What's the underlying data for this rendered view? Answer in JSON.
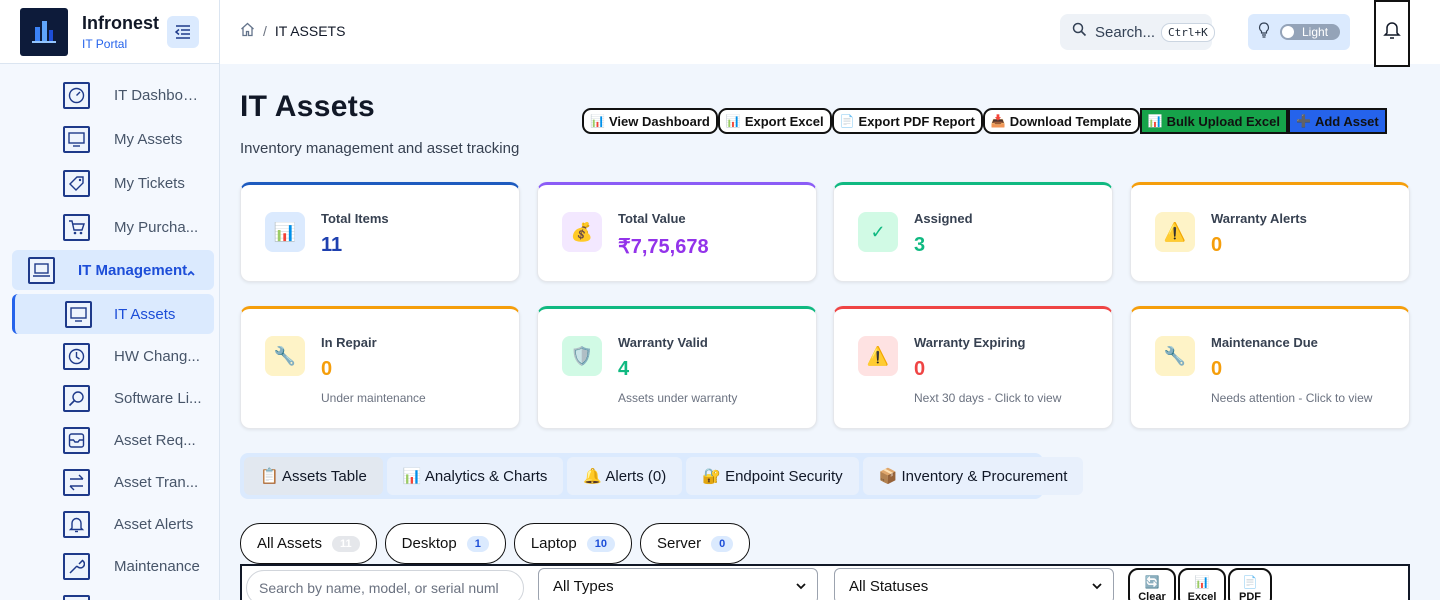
{
  "brand": {
    "name": "Infronest",
    "subtitle": "IT Portal"
  },
  "sidebar": {
    "items": [
      {
        "label": "IT Dashboard",
        "icon": "speedometer-icon"
      },
      {
        "label": "My Assets",
        "icon": "monitor-icon"
      },
      {
        "label": "My Tickets",
        "icon": "ticket-icon"
      },
      {
        "label": "My Purcha...",
        "icon": "cart-icon"
      }
    ],
    "group": {
      "label": "IT Management",
      "icon": "laptop-icon"
    },
    "active": {
      "label": "IT Assets",
      "icon": "monitor-icon"
    },
    "sub_items": [
      {
        "label": "HW Chang...",
        "icon": "clock-icon"
      },
      {
        "label": "Software Li...",
        "icon": "search-icon"
      },
      {
        "label": "Asset Req...",
        "icon": "inbox-icon"
      },
      {
        "label": "Asset Tran...",
        "icon": "transfer-icon"
      },
      {
        "label": "Asset Alerts",
        "icon": "bell-icon"
      },
      {
        "label": "Maintenance",
        "icon": "wrench-icon"
      }
    ]
  },
  "topbar": {
    "breadcrumb": {
      "current": "IT ASSETS",
      "separator": "/"
    },
    "search": {
      "label": "Search...",
      "shortcut": "Ctrl+K"
    },
    "theme": {
      "label": "Light"
    }
  },
  "header": {
    "title": "IT Assets",
    "subtitle": "Inventory management and asset tracking",
    "actions": [
      {
        "label": "View Dashboard",
        "icon": "📊"
      },
      {
        "label": "Export Excel",
        "icon": "📊"
      },
      {
        "label": "Export PDF Report",
        "icon": "📄"
      },
      {
        "label": "Download Template",
        "icon": "📥"
      },
      {
        "label": "Bulk Upload Excel",
        "icon": "📊"
      },
      {
        "label": "Add Asset",
        "icon": "➕"
      }
    ]
  },
  "stats": [
    {
      "label": "Total Items",
      "value": "11",
      "note": "",
      "icon": "📊",
      "color": "#1e40af",
      "accent": "#1e5bbf",
      "icon_bg": "#dbeafe"
    },
    {
      "label": "Total Value",
      "value": "₹7,75,678",
      "note": "",
      "icon": "💰",
      "color": "#9333ea",
      "accent": "#8b5cf6",
      "icon_bg": "#f3e8ff"
    },
    {
      "label": "Assigned",
      "value": "3",
      "note": "",
      "icon": "✓",
      "color": "#10b981",
      "accent": "#10b981",
      "icon_bg": "#d1fae5"
    },
    {
      "label": "Warranty Alerts",
      "value": "0",
      "note": "",
      "icon": "⚠️",
      "color": "#f59e0b",
      "accent": "#f59e0b",
      "icon_bg": "#fef3c7"
    },
    {
      "label": "In Repair",
      "value": "0",
      "note": "Under maintenance",
      "icon": "🔧",
      "color": "#f59e0b",
      "accent": "#f59e0b",
      "icon_bg": "#fef3c7"
    },
    {
      "label": "Warranty Valid",
      "value": "4",
      "note": "Assets under warranty",
      "icon": "🛡️",
      "color": "#10b981",
      "accent": "#10b981",
      "icon_bg": "#d1fae5"
    },
    {
      "label": "Warranty Expiring",
      "value": "0",
      "note": "Next 30 days - Click to view",
      "icon": "⚠️",
      "color": "#ef4444",
      "accent": "#ef4444",
      "icon_bg": "#fee2e2"
    },
    {
      "label": "Maintenance Due",
      "value": "0",
      "note": "Needs attention - Click to view",
      "icon": "🔧",
      "color": "#f59e0b",
      "accent": "#f59e0b",
      "icon_bg": "#fef3c7"
    }
  ],
  "tabs": [
    {
      "label": "📋 Assets Table"
    },
    {
      "label": "📊 Analytics & Charts"
    },
    {
      "label": "🔔 Alerts (0)"
    },
    {
      "label": "🔐 Endpoint Security"
    },
    {
      "label": "📦 Inventory & Procurement"
    }
  ],
  "type_filters": [
    {
      "label": "All Assets",
      "count": "11"
    },
    {
      "label": "Desktop",
      "count": "1"
    },
    {
      "label": "Laptop",
      "count": "10"
    },
    {
      "label": "Server",
      "count": "0"
    }
  ],
  "filters": {
    "search_placeholder": "Search by name, model, or serial numl",
    "type_select": "All Types",
    "status_select": "All Statuses",
    "mini_buttons": [
      {
        "label": "Clear",
        "icon": "🔄"
      },
      {
        "label": "Excel",
        "icon": "📊"
      },
      {
        "label": "PDF",
        "icon": "📄"
      }
    ]
  }
}
